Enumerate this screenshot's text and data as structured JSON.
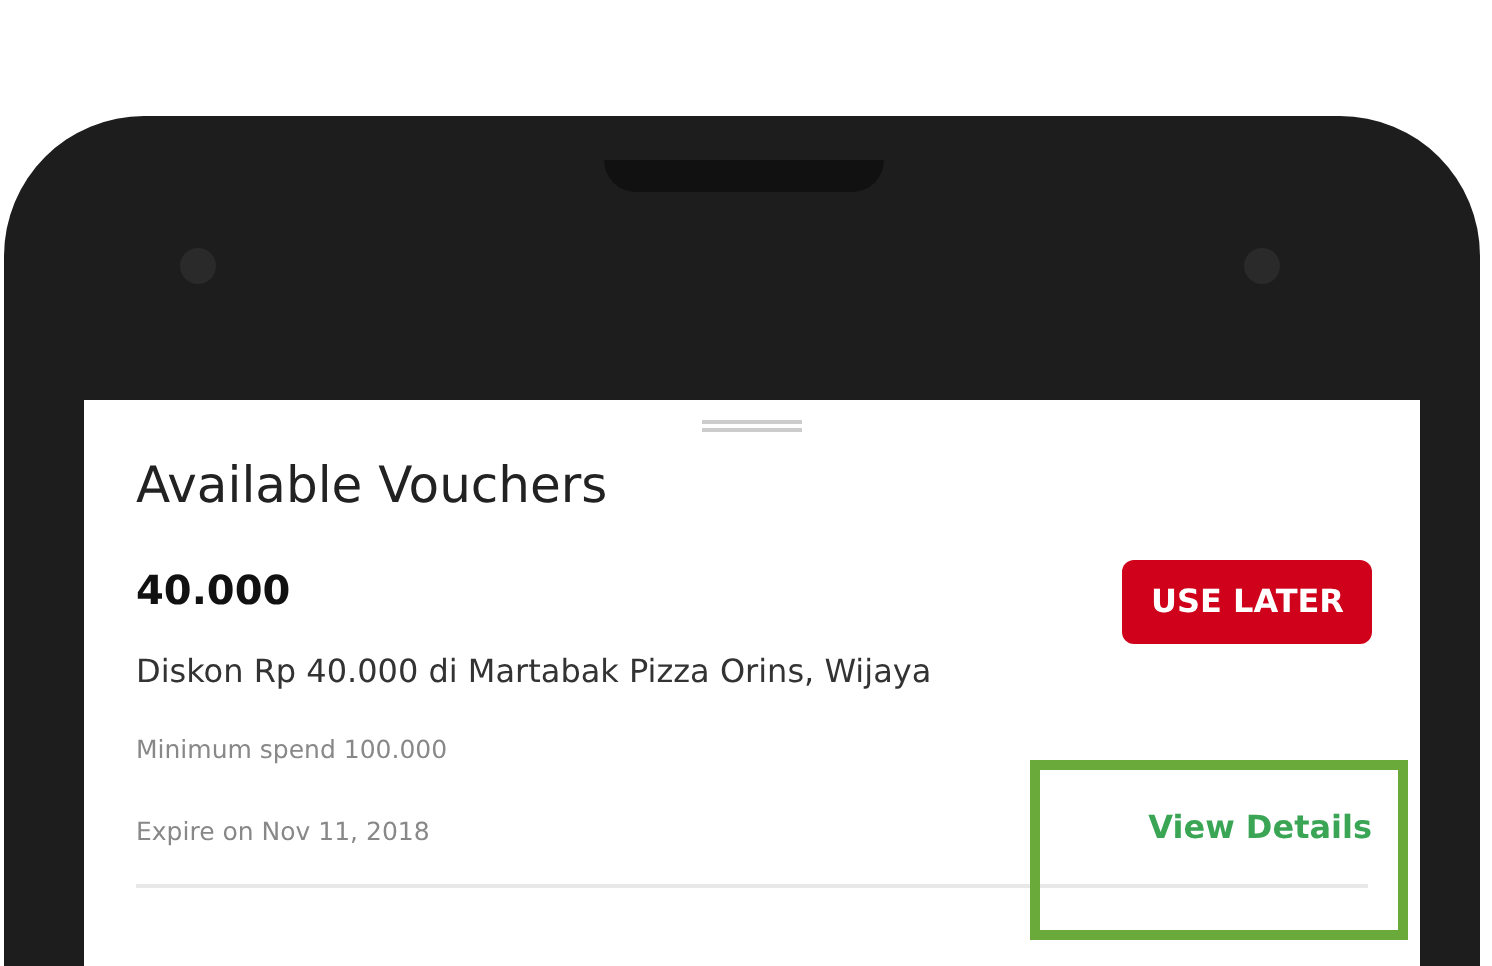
{
  "screen": {
    "title": "Available Vouchers"
  },
  "vouchers": [
    {
      "amount": "40.000",
      "description": "Diskon Rp 40.000 di Martabak Pizza Orins, Wijaya",
      "minimum": "Minimum spend 100.000",
      "expiry": "Expire on Nov 11, 2018",
      "action_button": "USE LATER",
      "details_link": "View Details",
      "highlighted": true
    }
  ]
}
